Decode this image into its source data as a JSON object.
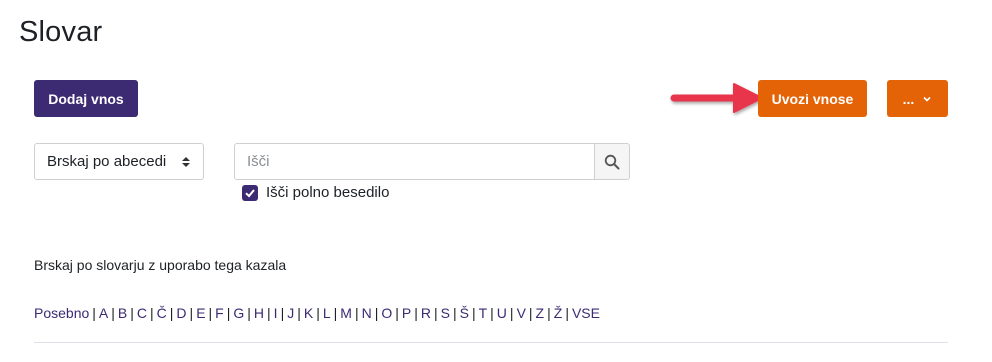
{
  "page": {
    "title": "Slovar"
  },
  "toolbar": {
    "add_label": "Dodaj vnos",
    "import_label": "Uvozi vnose",
    "more_label": "..."
  },
  "filters": {
    "browse_select_value": "Brskaj po abecedi",
    "search_placeholder": "Išči",
    "search_value": "",
    "fulltext_label": "Išči polno besedilo",
    "fulltext_checked": true
  },
  "index": {
    "intro": "Brskaj po slovarju z uporabo tega kazala",
    "letters": [
      "Posebno",
      "A",
      "B",
      "C",
      "Č",
      "D",
      "E",
      "F",
      "G",
      "H",
      "I",
      "J",
      "K",
      "L",
      "M",
      "N",
      "O",
      "P",
      "R",
      "S",
      "Š",
      "T",
      "U",
      "V",
      "Z",
      "Ž",
      "VSE"
    ]
  },
  "colors": {
    "primary": "#3c2a73",
    "accent": "#e46307",
    "annotation_arrow": "#e8364b"
  },
  "icons": {
    "search": "search-icon",
    "dropdown": "chevron-down-icon",
    "select": "updown-icon",
    "checkbox": "check-icon",
    "annotation": "arrow-right-icon"
  }
}
